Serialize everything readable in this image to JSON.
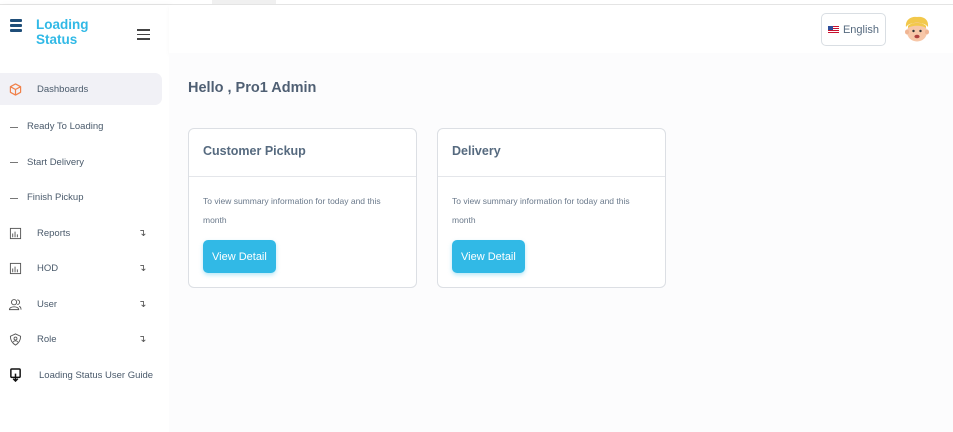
{
  "brand": {
    "title": "Loading Status"
  },
  "sidebar": {
    "items": [
      {
        "label": "Dashboards",
        "icon": "cube-icon",
        "active": true
      },
      {
        "label": "Ready To Loading",
        "sub": true
      },
      {
        "label": "Start Delivery",
        "sub": true
      },
      {
        "label": "Finish Pickup",
        "sub": true
      },
      {
        "label": "Reports",
        "icon": "report-chart-icon",
        "arrow": "↴"
      },
      {
        "label": "HOD",
        "icon": "report-chart-icon",
        "arrow": "↴"
      },
      {
        "label": "User",
        "icon": "users-icon",
        "arrow": "↴"
      },
      {
        "label": "Role",
        "icon": "shield-user-icon",
        "arrow": "↴"
      },
      {
        "label": "Loading Status User Guide",
        "icon": "download-guide-icon"
      }
    ]
  },
  "header": {
    "language": "English",
    "flag": "us-flag-icon"
  },
  "main": {
    "greeting": "Hello , Pro1 Admin",
    "cards": [
      {
        "title": "Customer Pickup",
        "description": "To view summary information for today and this month",
        "button": "View Detail"
      },
      {
        "title": "Delivery",
        "description": "To view summary information for today and this month",
        "button": "View Detail"
      }
    ]
  },
  "colors": {
    "accent": "#31b9e6",
    "brand_dark": "#1f4e79",
    "active_icon": "#f0814a"
  }
}
